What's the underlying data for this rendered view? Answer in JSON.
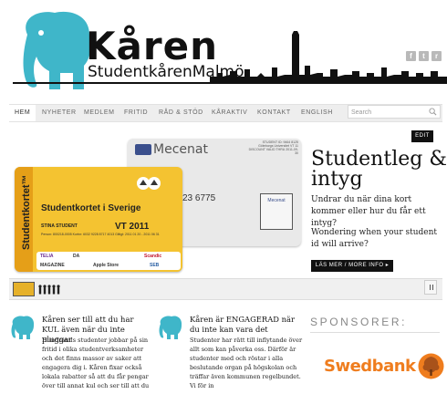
{
  "brand": {
    "title": "Kåren",
    "subtitle_a": "Studentkåren",
    "subtitle_b": "Malmö",
    "colors": {
      "elephant": "#3fb6c9",
      "dark": "#111111",
      "accent_orange": "#ef7d1e"
    }
  },
  "social": [
    {
      "icon": "facebook-icon",
      "glyph": "f"
    },
    {
      "icon": "twitter-icon",
      "glyph": "t"
    },
    {
      "icon": "rss-icon",
      "glyph": "r"
    }
  ],
  "nav": {
    "items": [
      "HEM",
      "NYHETER",
      "MEDLEM",
      "FRITID",
      "RÅD & STÖD",
      "KÅRAKTIV",
      "KONTAKT",
      "ENGLISH"
    ],
    "active": "HEM"
  },
  "search": {
    "placeholder": "Search"
  },
  "slider": {
    "edit_label": "EDIT",
    "title": "Studentleg & intyg",
    "text_sv": "Undrar du när dina kort kommer eller hur du får ett intyg?",
    "text_en": "Wondering when your student id will arrive?",
    "button_label": "LÄS MER / MORE INFO ▸",
    "card_gray": {
      "brand": "Mecenat",
      "number": "23 6775",
      "small_text": "STUDENT ID: 9464 8125 Göteborgs Universitet VT 11 DISCOUNT VALID THRU 2011-09-30",
      "badge": "Mecenat"
    },
    "card_yellow": {
      "vertical_label": "Studentkortet™",
      "title": "Studentkortet i Sverige",
      "name": "STINA STUDENT",
      "term": "VT 2011",
      "details": "Person: 800218-0005  Kortnr: 6032 9228 8717 4013  Giltigt: 2011 01 20 - 2011 06 31",
      "logos": [
        "TELIA",
        "DA",
        "Scandic",
        "MAGAZINE",
        "Apple Store",
        "SEB"
      ]
    }
  },
  "columns": [
    {
      "heading": "Kåren ser till att du har KUL även när du inte pluggar",
      "body": "Hundratals studenter jobbar på sin fritid i olika studentverksamheter och det finns massor av saker att engagera dig i. Kåren fixar också lokala rabatter så att du får pengar över till annat kul och ser till att du"
    },
    {
      "heading": "Kåren är ENGAGERAD när du inte kan vara det",
      "body": "Studenter har rätt till inflytande över allt som kan påverka oss. Därför är studenter med och röstar i alla beslutande organ på högskolan och träffar även kommunen regelbundet. Vi för in"
    }
  ],
  "sponsors": {
    "title": "SPONSORER:",
    "items": [
      {
        "name": "Swedbank"
      }
    ]
  }
}
